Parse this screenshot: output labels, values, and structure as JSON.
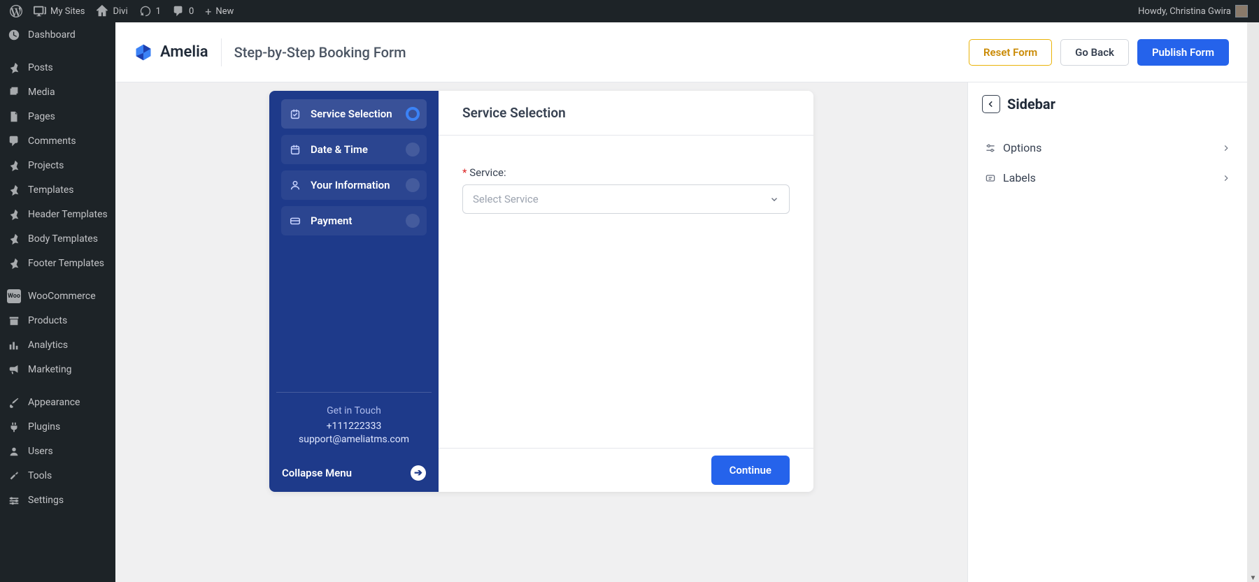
{
  "adminbar": {
    "mysites": "My Sites",
    "site_name": "Divi",
    "updates": "1",
    "comments": "0",
    "new": "New",
    "howdy": "Howdy, Christina Gwira"
  },
  "wp_menu": {
    "dashboard": "Dashboard",
    "posts": "Posts",
    "media": "Media",
    "pages": "Pages",
    "comments": "Comments",
    "projects": "Projects",
    "templates": "Templates",
    "header_templates": "Header Templates",
    "body_templates": "Body Templates",
    "footer_templates": "Footer Templates",
    "woocommerce": "WooCommerce",
    "products": "Products",
    "analytics": "Analytics",
    "marketing": "Marketing",
    "appearance": "Appearance",
    "plugins": "Plugins",
    "users": "Users",
    "tools": "Tools",
    "settings": "Settings"
  },
  "header": {
    "brand": "Amelia",
    "title": "Step-by-Step Booking Form",
    "reset": "Reset Form",
    "back": "Go Back",
    "publish": "Publish Form"
  },
  "booking": {
    "steps": {
      "service": "Service Selection",
      "datetime": "Date & Time",
      "info": "Your Information",
      "payment": "Payment"
    },
    "contact": {
      "title": "Get in Touch",
      "phone": "+111222333",
      "email": "support@ameliatms.com"
    },
    "collapse": "Collapse Menu",
    "main": {
      "heading": "Service Selection",
      "field_label": "Service:",
      "placeholder": "Select Service",
      "continue": "Continue"
    }
  },
  "props": {
    "title": "Sidebar",
    "options": "Options",
    "labels": "Labels"
  }
}
